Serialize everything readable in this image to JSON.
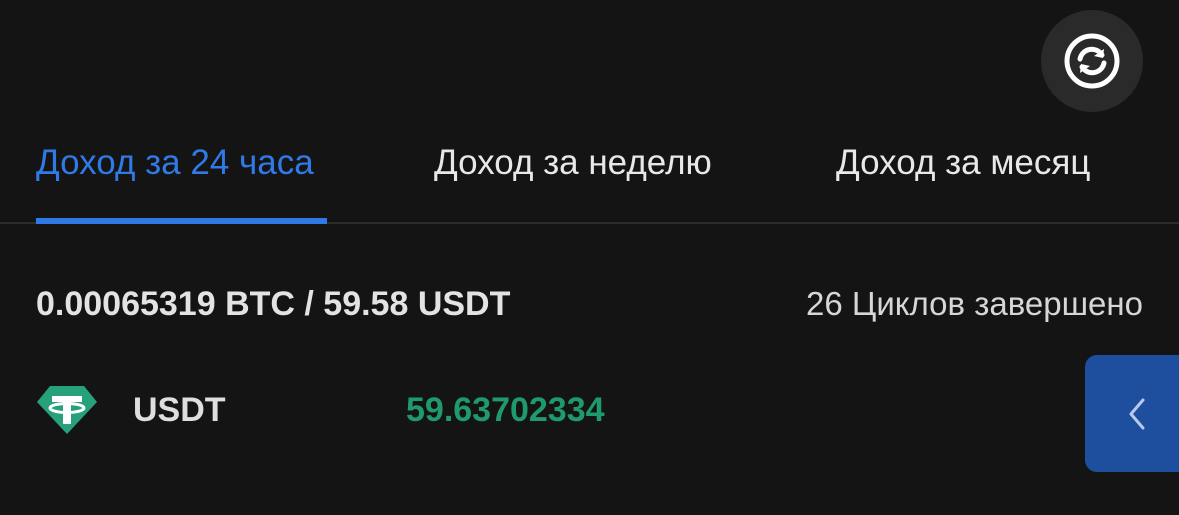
{
  "header": {
    "refresh_icon": "refresh-icon"
  },
  "tabs": [
    {
      "label": "Доход за 24 часа",
      "active": true
    },
    {
      "label": "Доход за неделю",
      "active": false
    },
    {
      "label": "Доход за месяц",
      "active": false
    }
  ],
  "summary": {
    "total": "0.00065319 BTC / 59.58 USDT",
    "cycles": "26 Циклов завершено"
  },
  "assets": [
    {
      "name": "USDT",
      "value": "59.63702334",
      "icon": "tether-icon"
    }
  ],
  "drawer": {
    "icon": "chevron-left-icon"
  },
  "colors": {
    "background": "#141414",
    "accent": "#2f7ae6",
    "positive": "#1f9a6c",
    "tether": "#26a17b",
    "handle": "#1e4f9e"
  }
}
